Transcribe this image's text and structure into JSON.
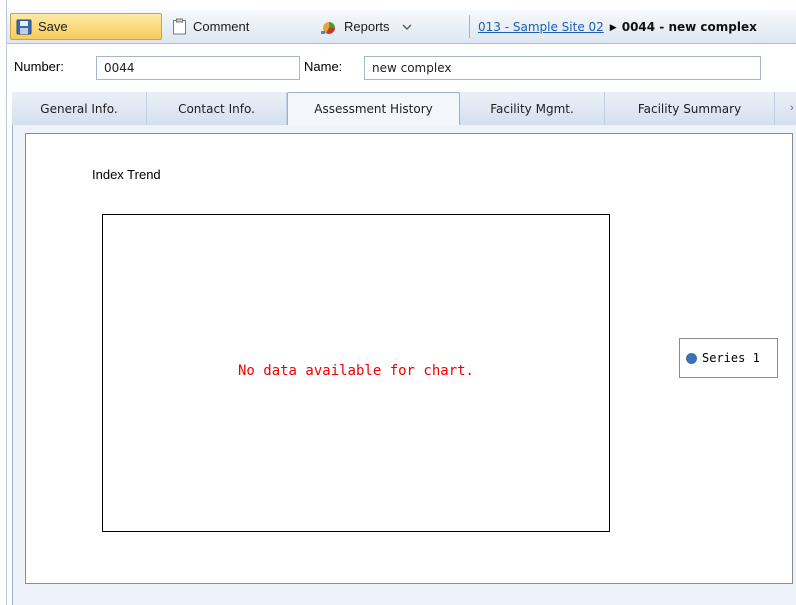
{
  "toolbar": {
    "save_label": "Save",
    "comment_label": "Comment",
    "reports_label": "Reports",
    "breadcrumb_parent": "013 - Sample Site 02",
    "breadcrumb_current": "0044 - new complex"
  },
  "form": {
    "number_label": "Number:",
    "number_value": "0044",
    "name_label": "Name:",
    "name_value": "new complex"
  },
  "tabs": [
    {
      "label": "General Info.",
      "active": false
    },
    {
      "label": "Contact Info.",
      "active": false
    },
    {
      "label": "Assessment History",
      "active": true
    },
    {
      "label": "Facility Mgmt.",
      "active": false
    },
    {
      "label": "Facility Summary",
      "active": false
    }
  ],
  "chart": {
    "title": "Index Trend",
    "no_data_message": "No data available for chart.",
    "legend": [
      {
        "label": "Series 1",
        "color": "#3b71b5"
      }
    ]
  },
  "colors": {
    "accent": "#f7cb5a",
    "link": "#1a5fb4",
    "error": "#ee0000"
  },
  "icons": [
    "save-icon",
    "comment-icon",
    "reports-icon",
    "chevron-down-icon",
    "breadcrumb-arrow-icon"
  ]
}
